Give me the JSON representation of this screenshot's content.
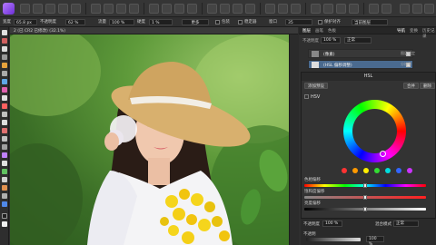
{
  "context_bar": {
    "width_label": "宽度",
    "width_value": "65.8 px",
    "opacity_label": "不透明度",
    "opacity_value": "62 %",
    "flow_label": "流量",
    "flow_value": "100 %",
    "hardness_label": "硬度",
    "hardness_value": "1 %",
    "more_label": "更多",
    "wrap_label": "包装",
    "stabilizer_label": "稳定器",
    "stabilizer_value": "35",
    "window_label": "窗口",
    "protect_label": "保护对齐",
    "current_layer_label": "当前图层"
  },
  "document": {
    "tab_title": "2 (已 CR2 已修改) (32.1%)"
  },
  "layers_panel": {
    "tabs": [
      "图层",
      "画笔",
      "色板"
    ],
    "opacity_label": "不透明度",
    "opacity_value": "100 %",
    "blend_value": "正常",
    "rows": [
      {
        "label": "(像素)"
      },
      {
        "label": "(HSL 偏移调整)"
      }
    ]
  },
  "right_tabs": {
    "tabs": [
      "导航",
      "变换",
      "历史记录",
      "通道"
    ],
    "items": [
      "图层锁定",
      "分辨率",
      "图层预览"
    ]
  },
  "hsl_dialog": {
    "title": "HSL",
    "add_preset": "添加预设",
    "merge": "合并",
    "delete": "删除",
    "hsv_label": "HSV",
    "swatch_colors": [
      "#ff3333",
      "#ff9900",
      "#ffee00",
      "#33dd33",
      "#00dddd",
      "#3366ff",
      "#cc33ff"
    ],
    "hue_label": "色相偏移",
    "saturation_label": "饱和度偏移",
    "luminosity_label": "亮度偏移",
    "hue_value": 0.5,
    "saturation_value": 0.5,
    "luminosity_value": 0.5
  },
  "bottom_bar": {
    "opacity_label": "不透明度",
    "opacity_value": "100 %",
    "blend_label": "混合模式",
    "blend_value": "正常",
    "zoom_label": "不透明",
    "zoom_value": "100 %"
  }
}
